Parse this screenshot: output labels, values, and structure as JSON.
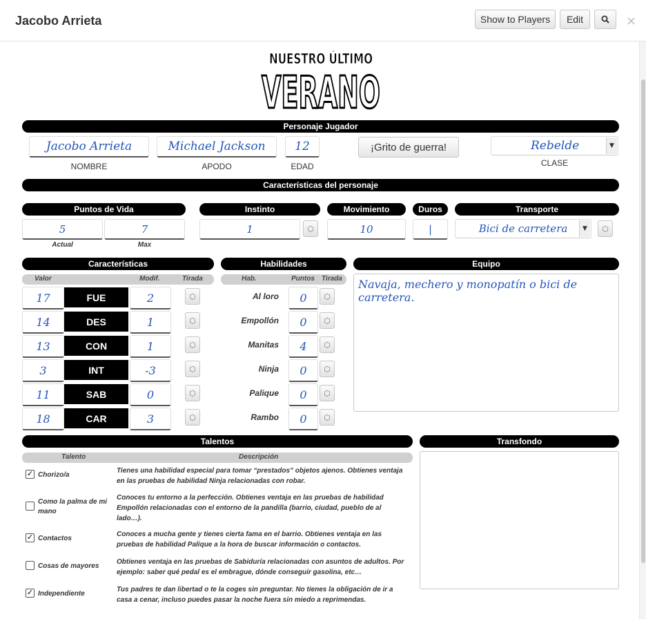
{
  "header": {
    "title": "Jacobo Arrieta",
    "show_players": "Show to Players",
    "edit": "Edit",
    "search_icon": "search-icon",
    "close": "×"
  },
  "logo": {
    "line1": "NUESTRO ÚLTIMO",
    "line2": "VERANO"
  },
  "player": {
    "section": "Personaje Jugador",
    "name": "Jacobo Arrieta",
    "name_label": "NOMBRE",
    "alias": "Michael Jackson",
    "alias_label": "APODO",
    "age": "12",
    "age_label": "EDAD",
    "war_cry": "¡Grito de guerra!",
    "class": "Rebelde",
    "class_label": "CLASE"
  },
  "traits": {
    "section": "Características del personaje",
    "hp_title": "Puntos de Vida",
    "hp_current": "5",
    "hp_current_label": "Actual",
    "hp_max": "7",
    "hp_max_label": "Max",
    "instinct_title": "Instinto",
    "instinct": "1",
    "movement_title": "Movimiento",
    "movement": "10",
    "money_title": "Duros",
    "money": "|",
    "transport_title": "Transporte",
    "transport": "Bici de carretera"
  },
  "stats": {
    "title": "Características",
    "col_value": "Valor",
    "col_mod": "Modif.",
    "col_roll": "Tirada",
    "rows": [
      {
        "value": "17",
        "name": "FUE",
        "mod": "2"
      },
      {
        "value": "14",
        "name": "DES",
        "mod": "1"
      },
      {
        "value": "13",
        "name": "CON",
        "mod": "1"
      },
      {
        "value": "3",
        "name": "INT",
        "mod": "-3"
      },
      {
        "value": "11",
        "name": "SAB",
        "mod": "0"
      },
      {
        "value": "18",
        "name": "CAR",
        "mod": "3"
      }
    ]
  },
  "skills": {
    "title": "Habilidades",
    "col_name": "Hab.",
    "col_points": "Puntos",
    "col_roll": "Tirada",
    "rows": [
      {
        "name": "Al loro",
        "points": "0"
      },
      {
        "name": "Empollón",
        "points": "0"
      },
      {
        "name": "Manitas",
        "points": "4"
      },
      {
        "name": "Ninja",
        "points": "0"
      },
      {
        "name": "Palique",
        "points": "0"
      },
      {
        "name": "Rambo",
        "points": "0"
      }
    ]
  },
  "equipment": {
    "title": "Equipo",
    "text": "Navaja, mechero y monopatín o bici de carretera."
  },
  "talents": {
    "title": "Talentos",
    "col_name": "Talento",
    "col_desc": "Descripción",
    "rows": [
      {
        "name": "Chorizo/a",
        "checked": "✓",
        "desc": "Tienes una habilidad especial para tomar “prestados” objetos ajenos. Obtienes ventaja en las pruebas de habilidad Ninja relacionadas con robar."
      },
      {
        "name": "Como la palma de mi mano",
        "checked": "",
        "desc": "Conoces tu entorno a la perfección. Obtienes ventaja en las pruebas de habilidad Empollón relacionadas con el entorno de la pandilla (barrio, ciudad, pueblo de al lado…)."
      },
      {
        "name": "Contactos",
        "checked": "✓",
        "desc": "Conoces a mucha gente y tienes cierta fama en el barrio. Obtienes ventaja en las pruebas de habilidad Palique a la hora de buscar información o contactos."
      },
      {
        "name": "Cosas de mayores",
        "checked": "",
        "desc": "Obtienes ventaja en las pruebas de Sabiduría relacionadas con asuntos de adultos. Por ejemplo: saber qué pedal es el embrague, dónde conseguir gasolina, etc…"
      },
      {
        "name": "Independiente",
        "checked": "✓",
        "desc": "Tus padres te dan libertad o te la coges sin preguntar. No tienes la obligación de ir a casa a cenar, incluso puedes pasar la noche fuera sin miedo a reprimendas."
      }
    ]
  },
  "background": {
    "title": "Transfondo",
    "text": ""
  }
}
